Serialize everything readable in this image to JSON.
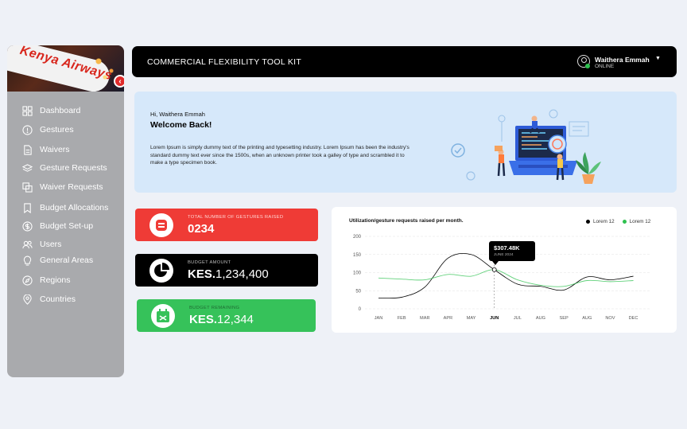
{
  "header": {
    "title": "COMMERCIAL FLEXIBILITY TOOL KIT",
    "user_name": "Waithera Emmah",
    "user_status": "ONLINE"
  },
  "sidebar": {
    "banner_text": "Kenya Airways",
    "items": [
      {
        "label": "Dashboard",
        "icon": "grid-icon"
      },
      {
        "label": "Gestures",
        "icon": "alert-circle-icon"
      },
      {
        "label": "Waivers",
        "icon": "document-icon"
      },
      {
        "label": "Gesture Requests",
        "icon": "layers-icon"
      },
      {
        "label": "Waiver Requests",
        "icon": "copy-icon"
      },
      {
        "label": "Budget Allocations",
        "icon": "bookmark-icon"
      },
      {
        "label": "Budget Set-up",
        "icon": "dollar-icon"
      },
      {
        "label": "Users",
        "icon": "users-icon"
      },
      {
        "label": "General Areas",
        "icon": "bulb-icon"
      },
      {
        "label": "Regions",
        "icon": "compass-icon"
      },
      {
        "label": "Countries",
        "icon": "location-pin-icon"
      }
    ]
  },
  "welcome": {
    "greeting": "Hi, Waithera Emmah",
    "title": "Welcome Back!",
    "body": "Lorem Ipsum is simply dummy text of the printing and typesetting industry. Lorem Ipsum has been the industry's standard dummy text ever since the 1500s, when an unknown printer took a galley of type and scrambled it to make a type specimen book."
  },
  "stats": [
    {
      "label": "TOTAL NUMBER OF GESTURES RAISED",
      "prefix": "",
      "value": "0234",
      "color": "#ef3b36"
    },
    {
      "label": "BUDGET AMOUNT",
      "prefix": "KES.",
      "value": "1,234,400",
      "color": "#000000"
    },
    {
      "label": "BUDGET REMAINING",
      "prefix": "KES.",
      "value": "12,344",
      "color": "#36c25a"
    }
  ],
  "chart_data": {
    "type": "line",
    "title": "Utilization/gesture requests raised per month.",
    "categories": [
      "JAN",
      "FEB",
      "MAR",
      "APR",
      "MAY",
      "JUN",
      "JUL",
      "AUG",
      "SEP",
      "AUG",
      "NOV",
      "DEC"
    ],
    "highlight_category": "JUN",
    "ylim": [
      0,
      200
    ],
    "yticks": [
      0,
      50,
      100,
      150,
      200
    ],
    "grid": true,
    "legend_position": "top-right",
    "series": [
      {
        "name": "Lorem 12",
        "color": "#000000",
        "values": [
          30,
          32,
          60,
          140,
          150,
          108,
          68,
          62,
          52,
          88,
          80,
          90
        ]
      },
      {
        "name": "Lorem 12",
        "color": "#2ec14f",
        "values": [
          85,
          82,
          80,
          95,
          90,
          108,
          80,
          65,
          62,
          78,
          75,
          78
        ]
      }
    ],
    "tooltip": {
      "value": "$307.48K",
      "date": "JUNE 2024"
    }
  }
}
